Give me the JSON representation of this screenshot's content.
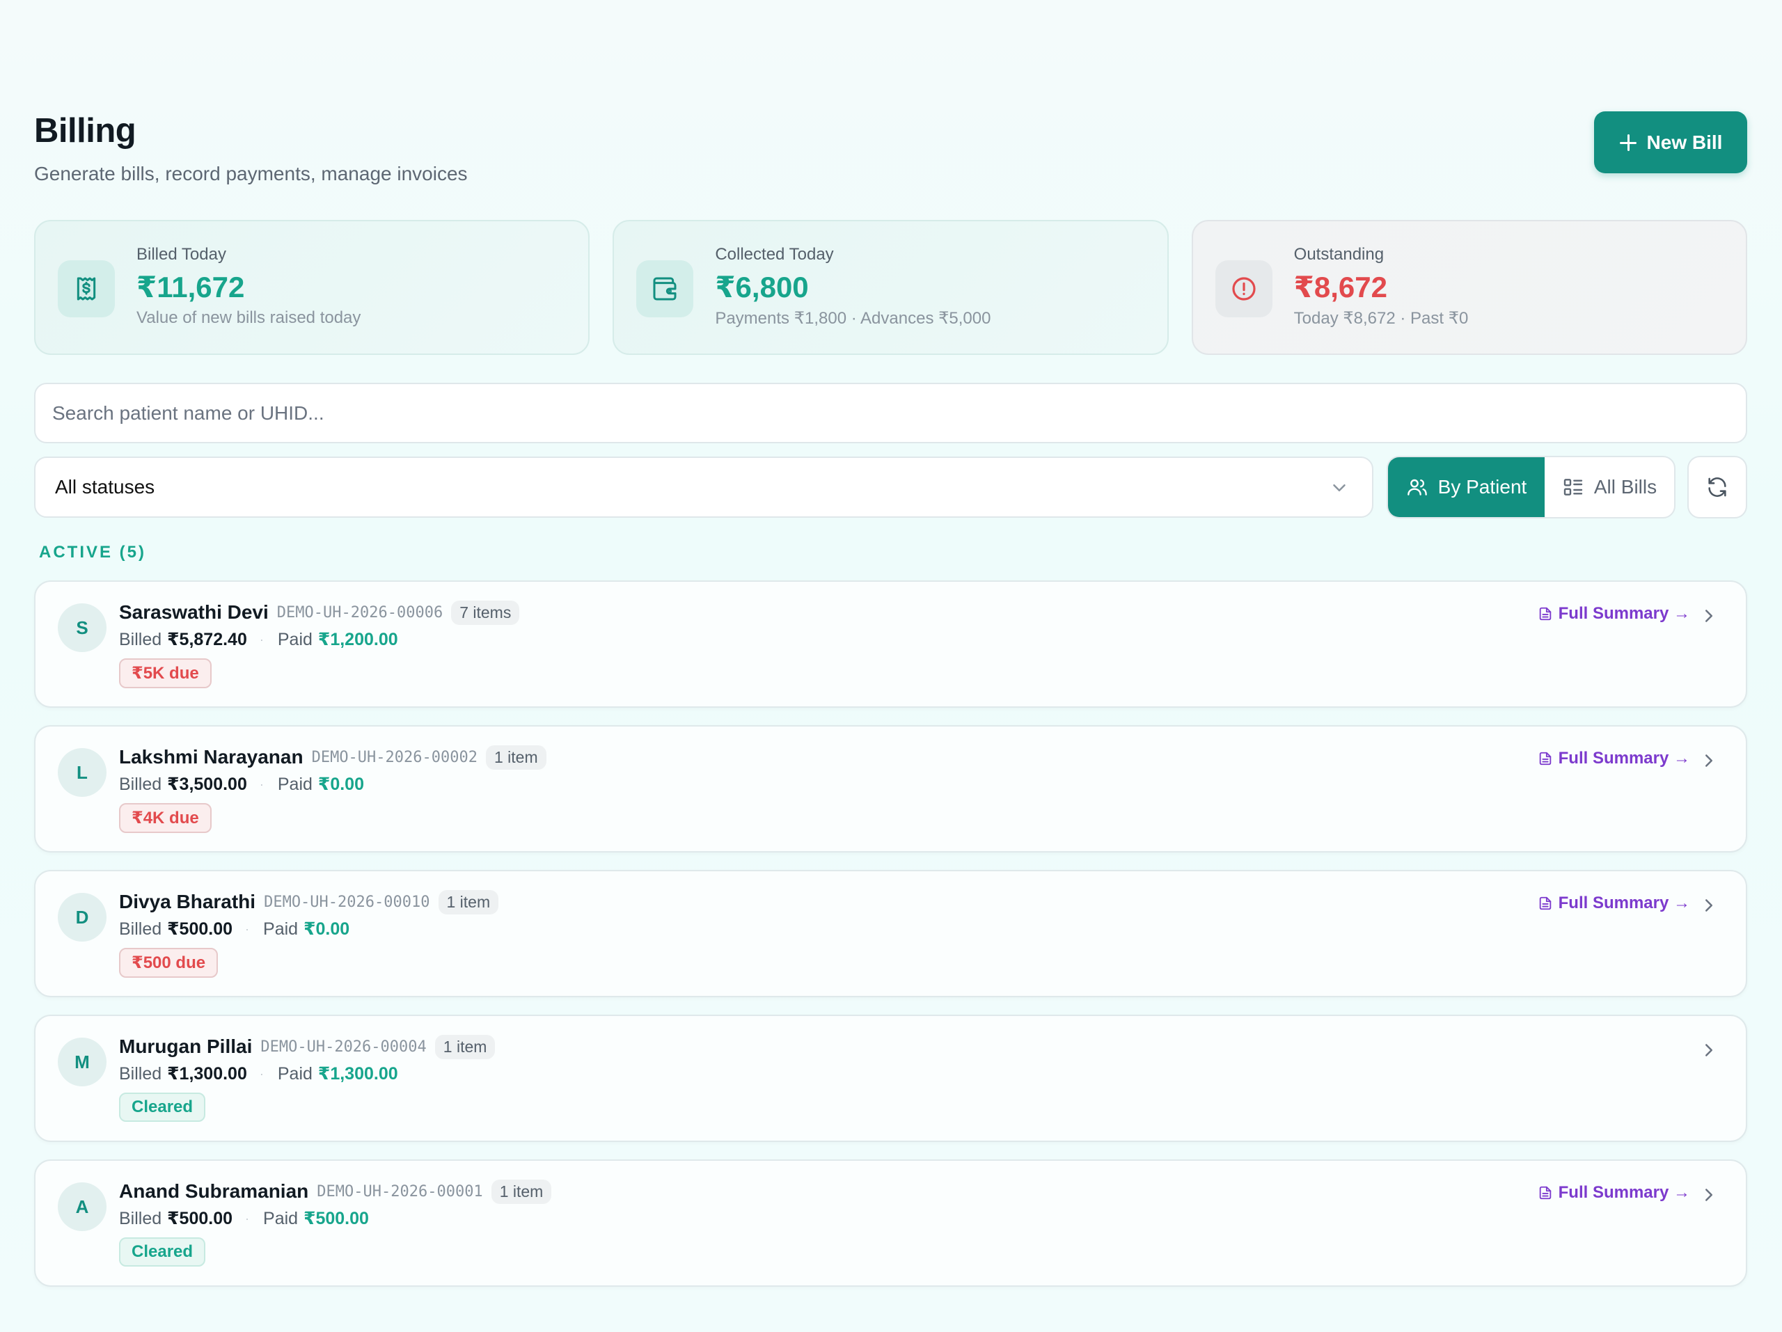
{
  "header": {
    "title": "Billing",
    "subtitle": "Generate bills, record payments, manage invoices",
    "new_bill_label": "New Bill"
  },
  "stats": [
    {
      "label": "Billed Today",
      "value": "₹11,672",
      "note": "Value of new bills raised today",
      "icon": "receipt-dollar-icon",
      "tone": "teal"
    },
    {
      "label": "Collected Today",
      "value": "₹6,800",
      "note": "Payments ₹1,800 · Advances ₹5,000",
      "icon": "wallet-icon",
      "tone": "teal"
    },
    {
      "label": "Outstanding",
      "value": "₹8,672",
      "note": "Today ₹8,672 · Past ₹0",
      "icon": "alert-circle-icon",
      "tone": "red"
    }
  ],
  "search": {
    "placeholder": "Search patient name or UHID..."
  },
  "filters": {
    "status_selected": "All statuses",
    "view_by_patient": "By Patient",
    "view_all_bills": "All Bills"
  },
  "section": {
    "label": "ACTIVE (5)"
  },
  "patients": [
    {
      "initial": "S",
      "name": "Saraswathi Devi",
      "uhid": "DEMO-UH-2026-00006",
      "items": "7 items",
      "billed_label": "Billed",
      "billed": "₹5,872.40",
      "paid_label": "Paid",
      "paid": "₹1,200.00",
      "badge": "₹5K due",
      "badge_type": "due",
      "summary_link": "Full Summary →"
    },
    {
      "initial": "L",
      "name": "Lakshmi Narayanan",
      "uhid": "DEMO-UH-2026-00002",
      "items": "1 item",
      "billed_label": "Billed",
      "billed": "₹3,500.00",
      "paid_label": "Paid",
      "paid": "₹0.00",
      "badge": "₹4K due",
      "badge_type": "due",
      "summary_link": "Full Summary →"
    },
    {
      "initial": "D",
      "name": "Divya Bharathi",
      "uhid": "DEMO-UH-2026-00010",
      "items": "1 item",
      "billed_label": "Billed",
      "billed": "₹500.00",
      "paid_label": "Paid",
      "paid": "₹0.00",
      "badge": "₹500 due",
      "badge_type": "due",
      "summary_link": "Full Summary →"
    },
    {
      "initial": "M",
      "name": "Murugan Pillai",
      "uhid": "DEMO-UH-2026-00004",
      "items": "1 item",
      "billed_label": "Billed",
      "billed": "₹1,300.00",
      "paid_label": "Paid",
      "paid": "₹1,300.00",
      "badge": "Cleared",
      "badge_type": "cleared",
      "summary_link": ""
    },
    {
      "initial": "A",
      "name": "Anand Subramanian",
      "uhid": "DEMO-UH-2026-00001",
      "items": "1 item",
      "billed_label": "Billed",
      "billed": "₹500.00",
      "paid_label": "Paid",
      "paid": "₹500.00",
      "badge": "Cleared",
      "badge_type": "cleared",
      "summary_link": "Full Summary →"
    }
  ],
  "colors": {
    "primary": "#128f80",
    "success": "#17a58c",
    "danger": "#e24a4d",
    "link": "#7c3acd"
  }
}
